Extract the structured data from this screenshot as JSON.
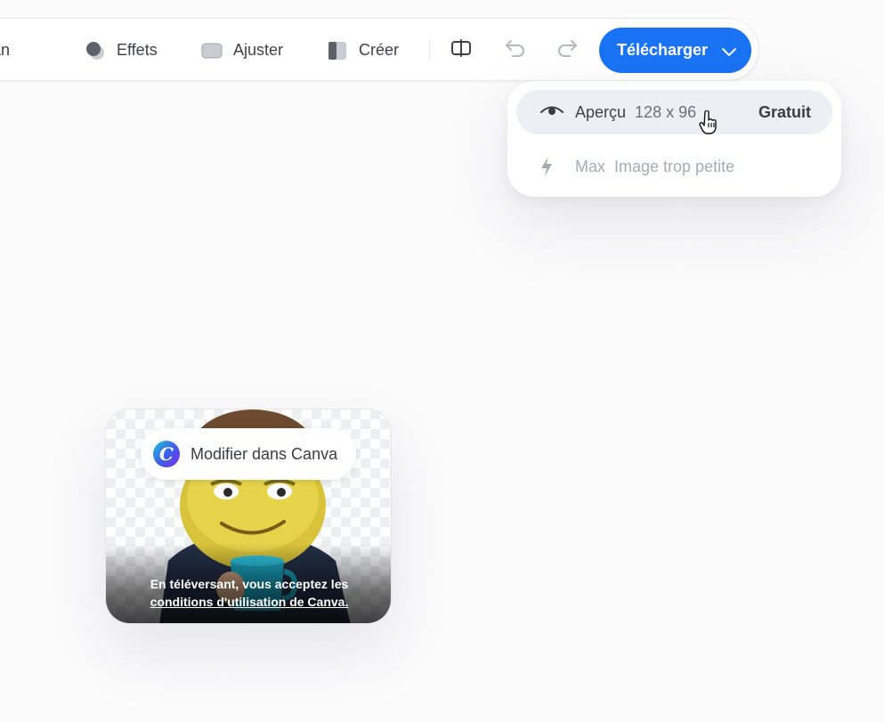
{
  "toolbar": {
    "items": [
      {
        "label": "e-plan",
        "icon": "foreground-icon"
      },
      {
        "label": "Effets",
        "icon": "effects-icon"
      },
      {
        "label": "Ajuster",
        "icon": "adjust-icon"
      },
      {
        "label": "Créer",
        "icon": "create-icon"
      }
    ],
    "compare_icon": "compare-icon",
    "undo_icon": "undo-icon",
    "redo_icon": "redo-icon",
    "download_label": "Télécharger",
    "accent_color": "#1a73f5"
  },
  "download_menu": {
    "options": [
      {
        "label": "Aperçu",
        "detail": "128 x 96",
        "badge": "Gratuit",
        "icon": "eye-icon",
        "state": "hovered"
      },
      {
        "label": "Max",
        "detail": "Image trop petite",
        "badge": "",
        "icon": "lightning-icon",
        "state": "disabled"
      }
    ]
  },
  "preview_card": {
    "edit_button_label": "Modifier dans Canva",
    "logo_letter": "C",
    "legal_text": "En téléversant, vous acceptez les",
    "legal_link": "conditions d'utilisation de Canva."
  }
}
